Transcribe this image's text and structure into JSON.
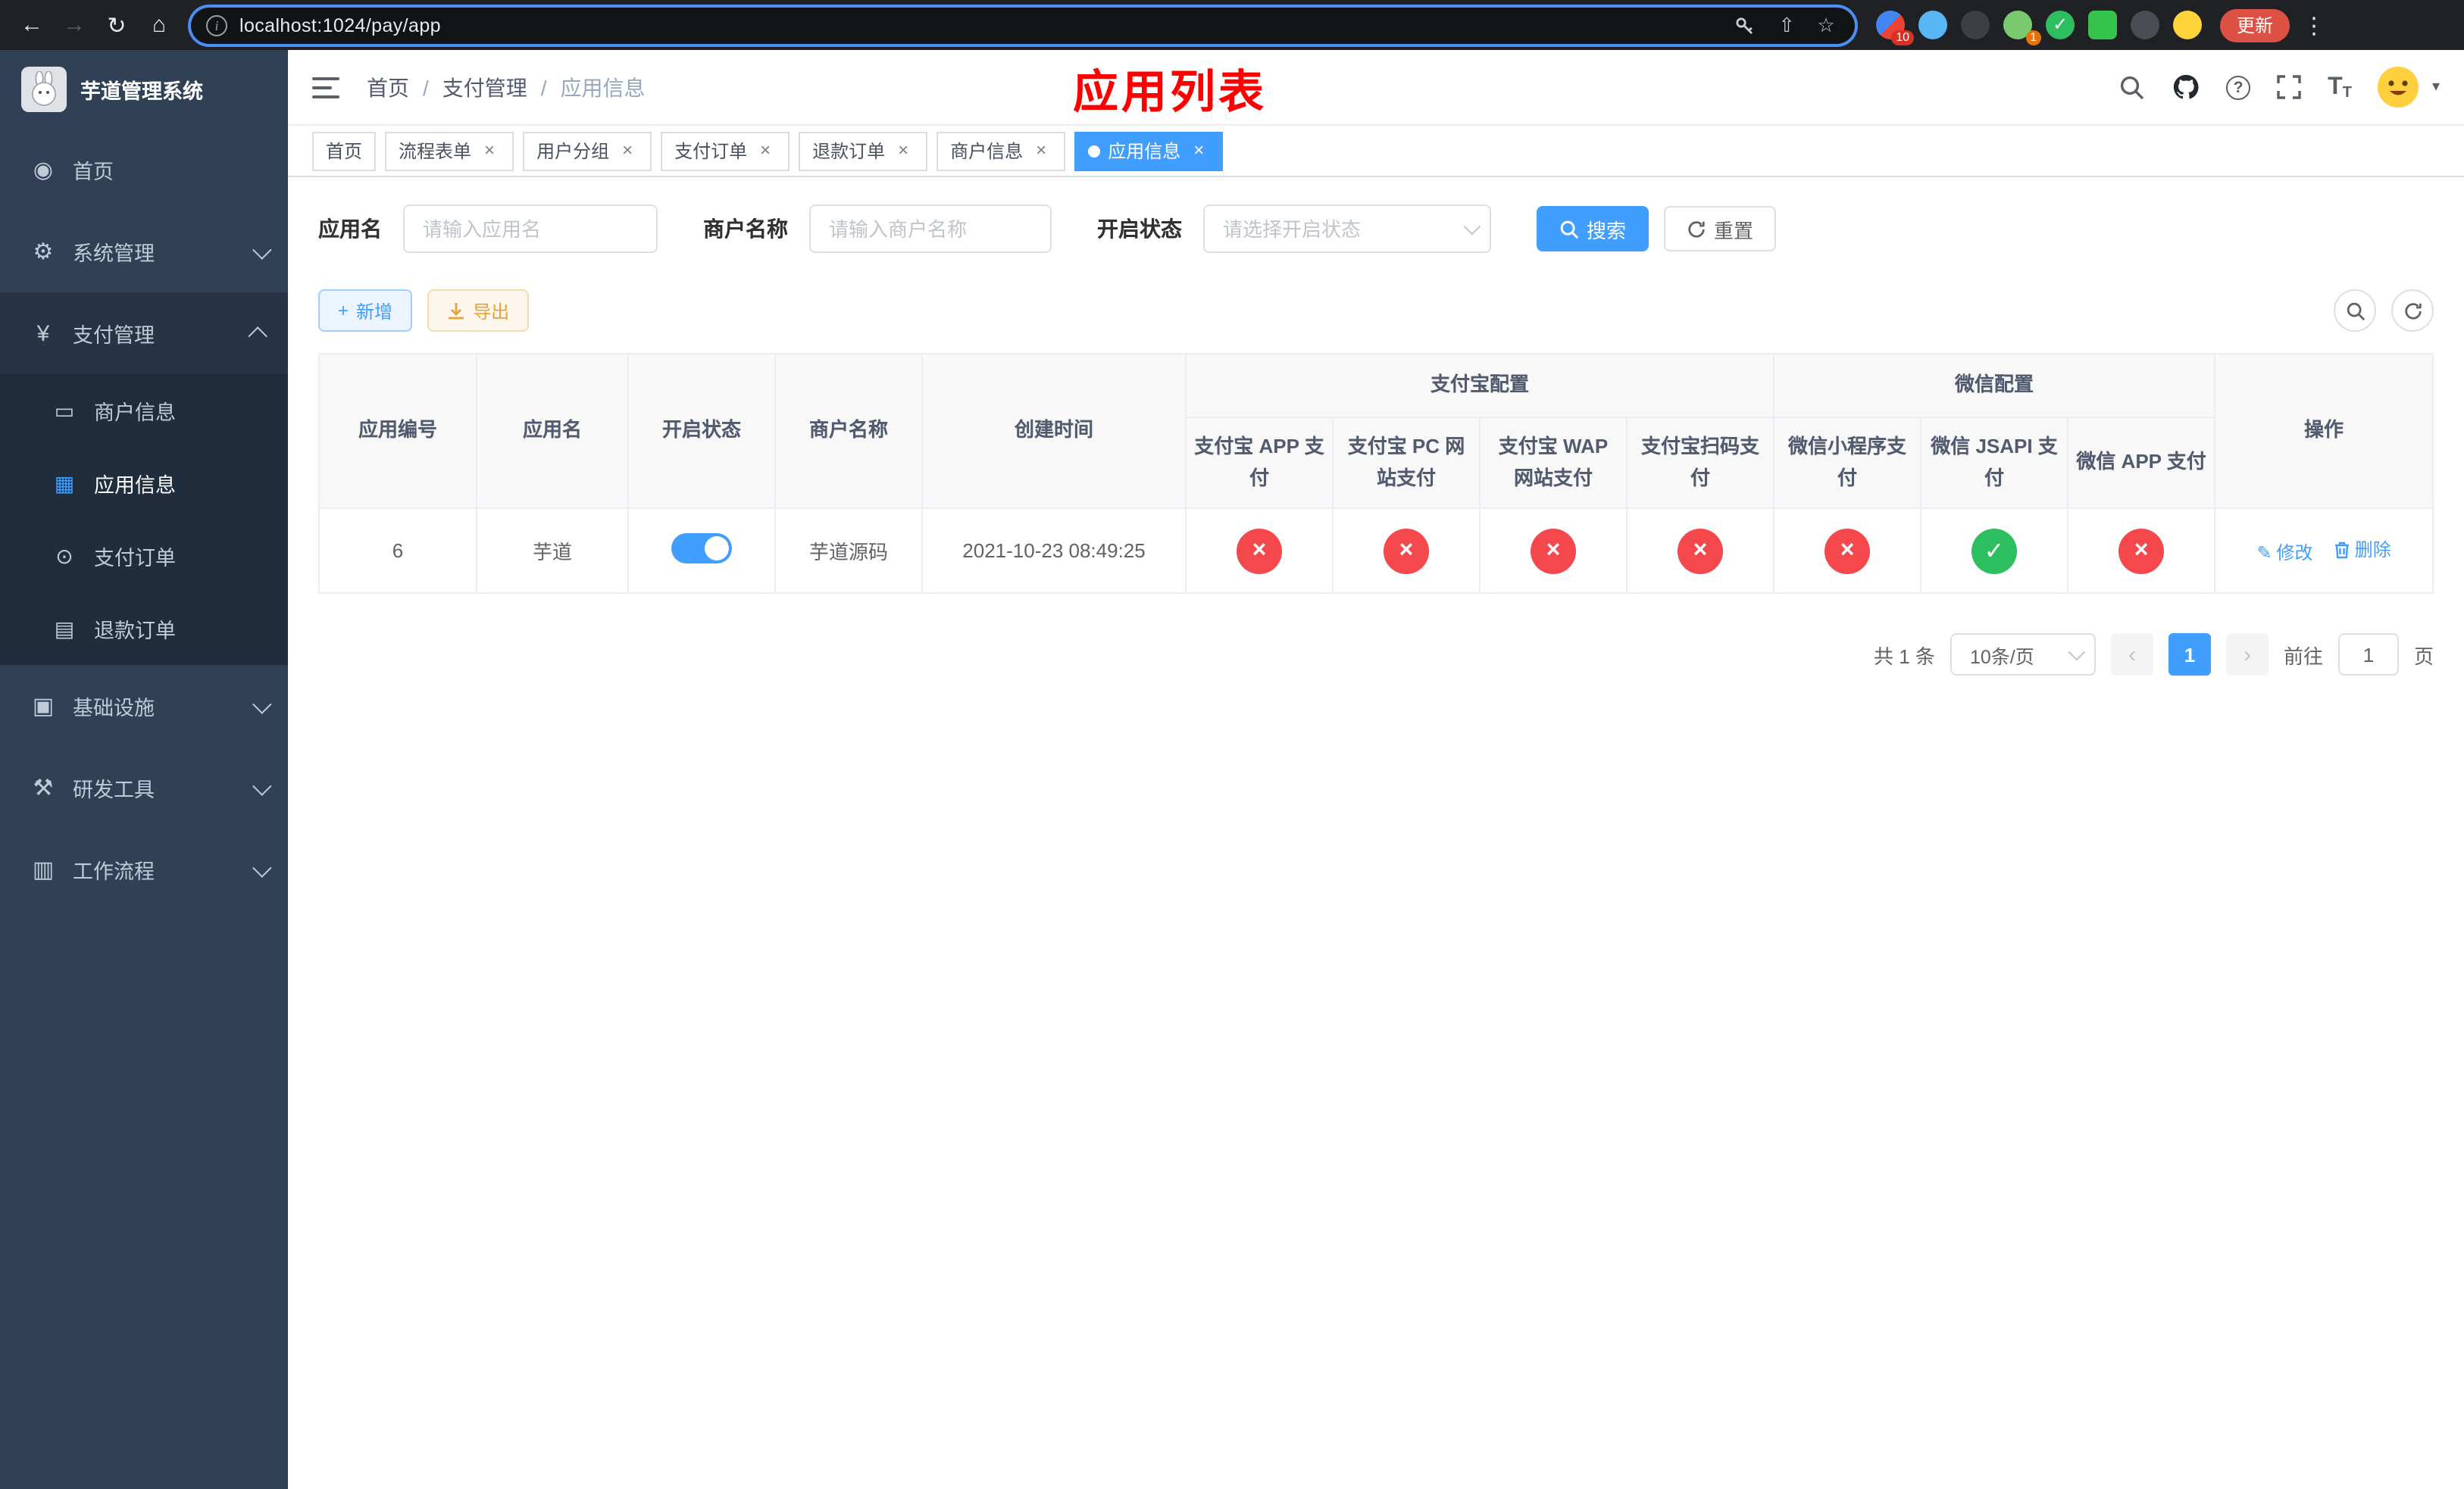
{
  "colors": {
    "primary": "#409eff",
    "success": "#2dbe60",
    "danger": "#f5484d",
    "warning": "#e6a23c",
    "annotation": "#ff0000",
    "sidebar_bg": "#304156",
    "submenu_bg": "#1f2d3d"
  },
  "browser": {
    "url": "localhost:1024/pay/app",
    "update_label": "更新",
    "ext_badge_a": "10",
    "ext_badge_b": "1"
  },
  "icons": {
    "back": "←",
    "forward": "→",
    "reload": "↻",
    "home": "⌂",
    "star": "☆",
    "share": "⇧",
    "kebab": "⋮",
    "dashboard": "◉",
    "gear": "⚙",
    "yen": "¥",
    "card": "▭",
    "grid": "▦",
    "order": "⊙",
    "doc": "▤",
    "infra": "▣",
    "tools": "⚒",
    "workflow": "▥",
    "plus": "+",
    "check": "✓",
    "cross": "×",
    "close": "×",
    "edit": "✎",
    "caret_down": "▾",
    "chev_left": "‹",
    "chev_right": "›",
    "refresh": "↻"
  },
  "sidebar": {
    "title": "芋道管理系统",
    "menu": [
      {
        "label": "首页"
      },
      {
        "label": "系统管理"
      },
      {
        "label": "支付管理"
      },
      {
        "label": "基础设施"
      },
      {
        "label": "研发工具"
      },
      {
        "label": "工作流程"
      }
    ],
    "payment_children": [
      {
        "label": "商户信息"
      },
      {
        "label": "应用信息"
      },
      {
        "label": "支付订单"
      },
      {
        "label": "退款订单"
      }
    ]
  },
  "header": {
    "breadcrumb": [
      {
        "label": "首页"
      },
      {
        "label": "支付管理"
      },
      {
        "label": "应用信息"
      }
    ],
    "annotation": "应用列表"
  },
  "tabs": {
    "items": [
      {
        "label": "首页"
      },
      {
        "label": "流程表单"
      },
      {
        "label": "用户分组"
      },
      {
        "label": "支付订单"
      },
      {
        "label": "退款订单"
      },
      {
        "label": "商户信息"
      },
      {
        "label": "应用信息"
      }
    ]
  },
  "filters": {
    "name_label": "应用名",
    "name_placeholder": "请输入应用名",
    "merchant_label": "商户名称",
    "merchant_placeholder": "请输入商户名称",
    "status_label": "开启状态",
    "status_placeholder": "请选择开启状态",
    "search_label": "搜索",
    "reset_label": "重置"
  },
  "toolbar": {
    "add_label": "新增",
    "export_label": "导出"
  },
  "table": {
    "group_alipay": "支付宝配置",
    "group_wechat": "微信配置",
    "col_id": "应用编号",
    "col_name": "应用名",
    "col_status": "开启状态",
    "col_merchant": "商户名称",
    "col_created": "创建时间",
    "col_alipay_app": "支付宝 APP 支付",
    "col_alipay_pc": "支付宝 PC 网站支付",
    "col_alipay_wap": "支付宝 WAP 网站支付",
    "col_alipay_qr": "支付宝扫码支付",
    "col_wx_lite": "微信小程序支付",
    "col_wx_jsapi": "微信 JSAPI 支付",
    "col_wx_app": "微信 APP 支付",
    "col_ops": "操作",
    "row": {
      "id": "6",
      "name": "芋道",
      "status_on": true,
      "merchant": "芋道源码",
      "created": "2021-10-23 08:49:25",
      "channels": [
        "fail",
        "fail",
        "fail",
        "fail",
        "fail",
        "success",
        "fail"
      ],
      "edit_label": "修改",
      "delete_label": "删除"
    }
  },
  "pagination": {
    "total": "共 1 条",
    "size": "10条/页",
    "page": "1",
    "goto_label": "前往",
    "goto_value": "1",
    "page_unit": "页"
  }
}
